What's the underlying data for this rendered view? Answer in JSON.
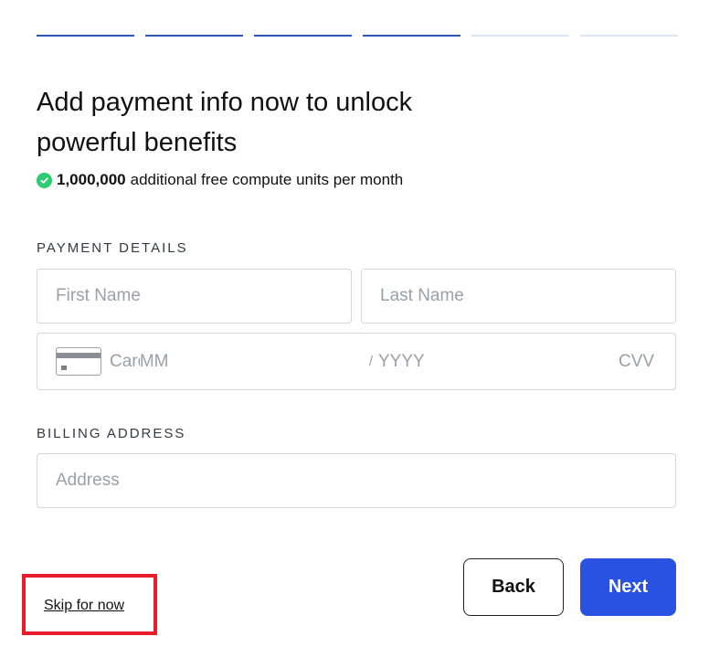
{
  "progress": {
    "total_steps": 6,
    "completed_steps": 4,
    "colors": {
      "done": "#2f54b8",
      "pending": "#dde5f2"
    }
  },
  "header": {
    "title_line1": "Add payment info now to unlock",
    "title_line2": "powerful benefits"
  },
  "benefit": {
    "icon": "check-circle-icon",
    "amount": "1,000,000",
    "text": "additional free compute units per month",
    "color": "#2ecc71"
  },
  "payment_details": {
    "label": "PAYMENT DETAILS",
    "first_name_placeholder": "First Name",
    "last_name_placeholder": "Last Name",
    "card_number_placeholder": "Card number",
    "month_placeholder": "MM",
    "separator": "/",
    "year_placeholder": "YYYY",
    "cvv_placeholder": "CVV"
  },
  "billing_address": {
    "label": "BILLING ADDRESS",
    "address_placeholder": "Address"
  },
  "actions": {
    "back_label": "Back",
    "next_label": "Next",
    "skip_label": "Skip for now",
    "primary_color": "#2952e3",
    "highlight_color": "#e81c2a"
  }
}
